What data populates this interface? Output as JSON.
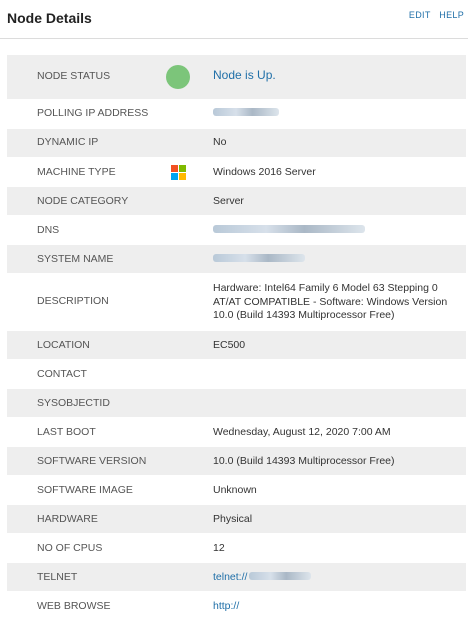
{
  "header": {
    "title": "Node Details",
    "edit_label": "EDIT",
    "help_label": "HELP"
  },
  "rows": [
    {
      "label": "NODE STATUS",
      "value": "Node is Up."
    },
    {
      "label": "POLLING IP ADDRESS",
      "value": ""
    },
    {
      "label": "DYNAMIC IP",
      "value": "No"
    },
    {
      "label": "MACHINE TYPE",
      "value": "Windows 2016 Server"
    },
    {
      "label": "NODE CATEGORY",
      "value": "Server"
    },
    {
      "label": "DNS",
      "value": ""
    },
    {
      "label": "SYSTEM NAME",
      "value": ""
    },
    {
      "label": "DESCRIPTION",
      "value": "Hardware: Intel64 Family 6 Model 63 Stepping 0 AT/AT COMPATIBLE - Software: Windows Version 10.0 (Build 14393 Multiprocessor Free)"
    },
    {
      "label": "LOCATION",
      "value": "EC500"
    },
    {
      "label": "CONTACT",
      "value": ""
    },
    {
      "label": "SYSOBJECTID",
      "value": ""
    },
    {
      "label": "LAST BOOT",
      "value": "Wednesday, August 12, 2020 7:00 AM"
    },
    {
      "label": "SOFTWARE VERSION",
      "value": "10.0 (Build 14393 Multiprocessor Free)"
    },
    {
      "label": "SOFTWARE IMAGE",
      "value": "Unknown"
    },
    {
      "label": "HARDWARE",
      "value": "Physical"
    },
    {
      "label": "NO OF CPUS",
      "value": "12"
    },
    {
      "label": "TELNET",
      "value": "telnet://"
    },
    {
      "label": "WEB BROWSE",
      "value": "http://"
    }
  ],
  "icons": {
    "status": "green-status-dot-icon",
    "machine": "windows-logo-icon"
  },
  "colors": {
    "status_up": "#7cc57a",
    "link": "#1f6fa8",
    "row_alt": "#eeeeee"
  }
}
